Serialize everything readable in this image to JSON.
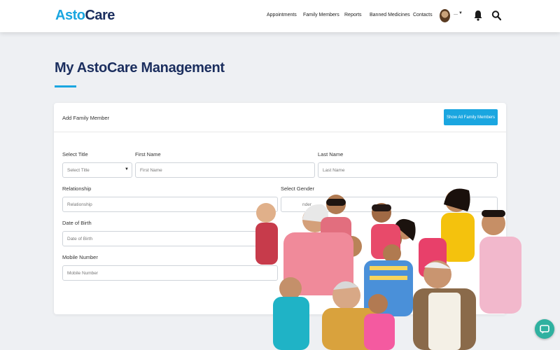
{
  "header": {
    "logo_part1": "Asto",
    "logo_part2": "Care",
    "nav": [
      "Appointments",
      "Family Members",
      "Reports",
      "Banned Medicines",
      "Contacts"
    ]
  },
  "page": {
    "title": "My AstoCare Management"
  },
  "card": {
    "header_title": "Add Family Member",
    "show_all_button": "Show All Family Members",
    "fields": {
      "select_title": {
        "label": "Select Title",
        "value": "Select Title"
      },
      "first_name": {
        "label": "First Name",
        "placeholder": "First Name"
      },
      "last_name": {
        "label": "Last Name",
        "placeholder": "Last Name"
      },
      "relationship": {
        "label": "Relationship",
        "value": "Relationship"
      },
      "gender": {
        "label": "Select Gender",
        "value": "nder"
      },
      "dob": {
        "label": "Date of Birth",
        "placeholder": "Date of Birth"
      },
      "mobile": {
        "label": "Mobile Number",
        "placeholder": "Mobile Number"
      }
    }
  },
  "colors": {
    "brand_blue": "#1aa6e0",
    "brand_navy": "#1b2e5e",
    "chat_fab": "#2fb1a0"
  },
  "icons": [
    "bell-icon",
    "search-icon",
    "chevron-down-icon",
    "chat-icon"
  ]
}
